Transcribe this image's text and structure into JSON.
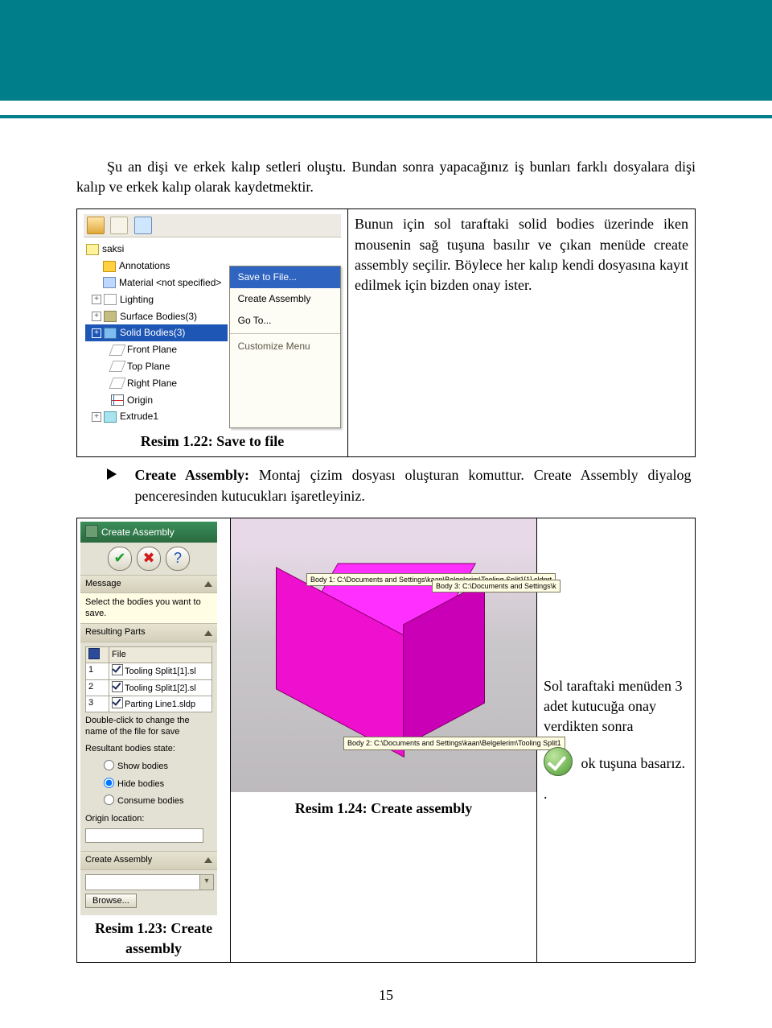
{
  "intro_paragraph": "Şu an dişi ve erkek kalıp setleri oluştu. Bundan sonra yapacağınız iş bunları farklı dosyalara dişi kalıp ve erkek kalıp olarak kaydetmektir.",
  "fig1": {
    "caption": "Resim 1.22: Save to file",
    "tree": {
      "root": "saksi",
      "items": [
        "Annotations",
        "Material <not specified>",
        "Lighting",
        "Surface Bodies(3)",
        "Solid Bodies(3)",
        "Front Plane",
        "Top Plane",
        "Right Plane",
        "Origin",
        "Extrude1"
      ]
    },
    "menu": [
      "Save to File...",
      "Create Assembly",
      "Go To...",
      "Customize Menu"
    ],
    "right_text": "Bunun için sol taraftaki solid bodies üzerinde iken mousenin sağ tuşuna basılır ve çıkan menüde create assembly seçilir. Böylece her kalıp kendi dosyasına kayıt edilmek için bizden onay ister."
  },
  "bullet": {
    "title": "Create Assembly:",
    "body": "Montaj çizim dosyası oluşturan komuttur. Create Assembly diyalog penceresinden kutucukları işaretleyiniz."
  },
  "pm": {
    "title": "Create Assembly",
    "message_h": "Message",
    "message": "Select the bodies you want to save.",
    "resulting_h": "Resulting Parts",
    "file_col": "File",
    "files": [
      "Tooling Split1[1].sl",
      "Tooling Split1[2].sl",
      "Parting Line1.sldp"
    ],
    "hint": "Double-click to change the name of the file for save",
    "state_h": "Resultant bodies state:",
    "radios": [
      "Show bodies",
      "Hide bodies",
      "Consume bodies"
    ],
    "origin_h": "Origin location:",
    "section_ca": "Create Assembly",
    "browse": "Browse...",
    "caption": "Resim 1.23:  Create assembly"
  },
  "vp": {
    "caption": "Resim 1.24: Create assembly",
    "tt1": "Body  1:  C:\\Documents and Settings\\kaan\\Belgelerim\\Tooling Split1[1].sldprt",
    "tt2": "Body  3:  C:\\Documents and Settings\\k",
    "tt3": "Body  2:  C:\\Documents and Settings\\kaan\\Belgelerim\\Tooling Split1"
  },
  "sidenote": {
    "p1": "Sol taraftaki menüden 3 adet kutucuğa onay verdikten sonra",
    "p2_a": "ok tuşuna basarız.",
    "dot": "."
  },
  "page_number": "15"
}
